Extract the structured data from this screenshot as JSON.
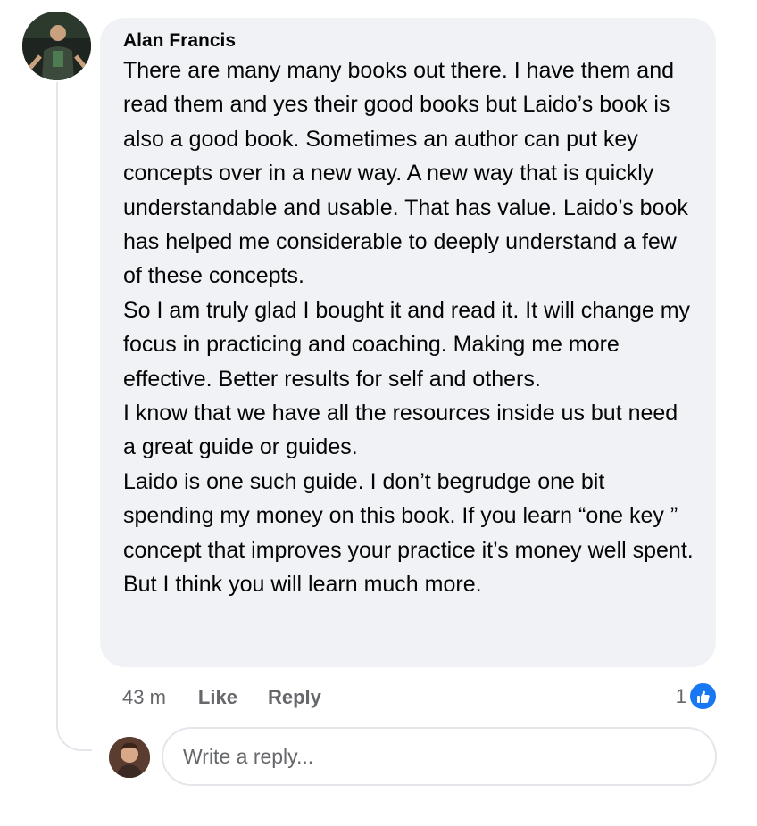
{
  "comment": {
    "author": "Alan Francis",
    "paragraphs": [
      "There are many many books out there. I have them and read them and yes their good books but Laido’s book is also a good book. Sometimes an author can put key concepts over in a new way. A new way that is quickly understandable and usable. That has value. Laido’s book has helped me considerable to deeply understand a few of these concepts.",
      "So I am truly glad I bought it and read it. It will change my focus in practicing and coaching. Making me more effective. Better results for self and others.",
      "I know that we have all the resources inside us but need a great guide or guides.",
      "Laido is one such guide. I don’t begrudge one bit spending my money on this book. If you learn “one key ” concept that improves your practice it’s money well spent. But I think you will learn much more."
    ],
    "time": "43 m",
    "like_label": "Like",
    "reply_label": "Reply",
    "reaction_count": "1",
    "reaction_icon": "thumbs-up-icon",
    "reaction_color": "#1877f2"
  },
  "reply_input": {
    "placeholder": "Write a reply..."
  }
}
